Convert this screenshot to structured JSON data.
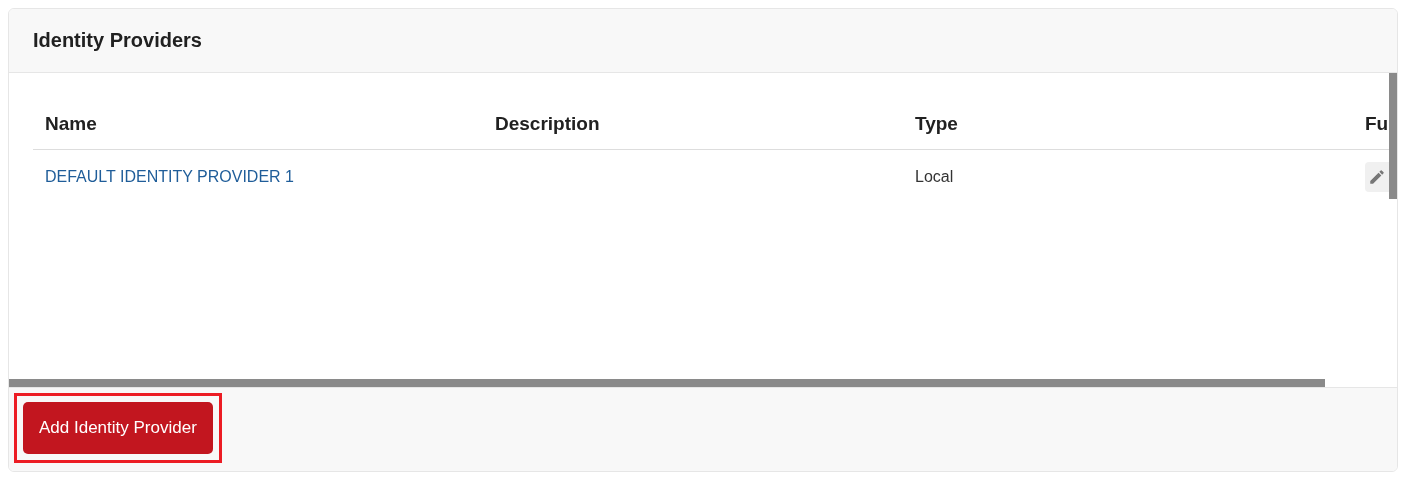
{
  "panel": {
    "title": "Identity Providers"
  },
  "table": {
    "columns": [
      "Name",
      "Description",
      "Type",
      "Fu"
    ],
    "rows": [
      {
        "name": "DEFAULT IDENTITY PROVIDER 1",
        "description": "",
        "type": "Local"
      }
    ]
  },
  "footer": {
    "button": {
      "label": "Add Identity Provider",
      "highlighted": true
    }
  }
}
